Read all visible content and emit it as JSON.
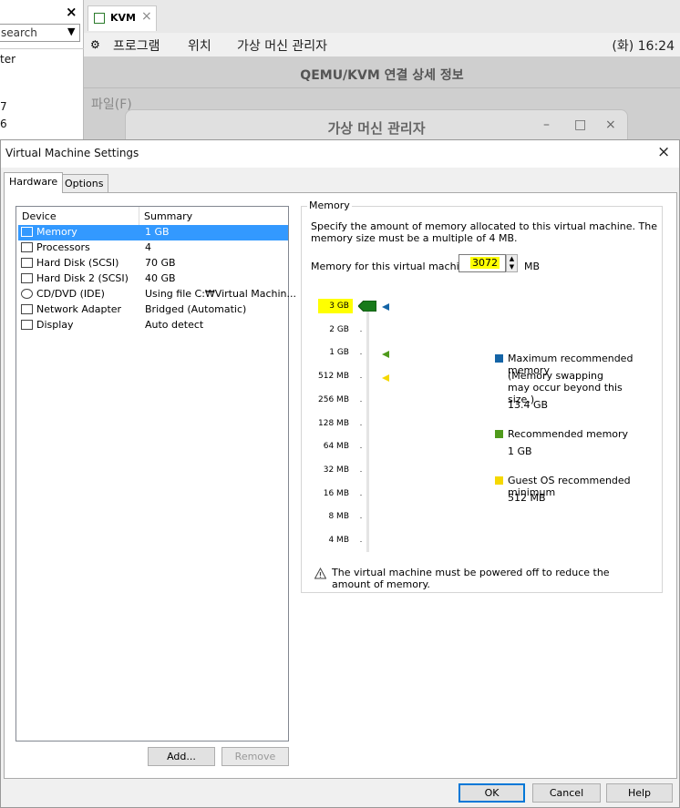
{
  "left_panel": {
    "close_glyph": "×",
    "search_text": "search",
    "items": [
      "ter",
      "7",
      "6"
    ]
  },
  "kvm_tab": {
    "label": "KVM",
    "close_glyph": "×"
  },
  "menubar": {
    "items": [
      "프로그램",
      "위치",
      "가상 머신 관리자"
    ],
    "clock": "(화) 16:24"
  },
  "qemu_window": {
    "title": "QEMU/KVM 연결 상세 정보",
    "file_menu": "파일(F)"
  },
  "vmm_window": {
    "title": "가상 머신 관리자",
    "minimize": "–",
    "maximize": "□",
    "close": "×"
  },
  "dialog": {
    "title": "Virtual Machine Settings",
    "close_glyph": "×",
    "tabs": {
      "hardware": "Hardware",
      "options": "Options"
    },
    "device_list": {
      "headers": {
        "device": "Device",
        "summary": "Summary"
      },
      "rows": [
        {
          "device": "Memory",
          "summary": "1 GB",
          "icon": "memory-icon"
        },
        {
          "device": "Processors",
          "summary": "4",
          "icon": "processor-icon"
        },
        {
          "device": "Hard Disk (SCSI)",
          "summary": "70 GB",
          "icon": "hard-disk-icon"
        },
        {
          "device": "Hard Disk 2 (SCSI)",
          "summary": "40 GB",
          "icon": "hard-disk-icon"
        },
        {
          "device": "CD/DVD (IDE)",
          "summary": "Using file C:₩Virtual Machin...",
          "icon": "cd-dvd-icon"
        },
        {
          "device": "Network Adapter",
          "summary": "Bridged (Automatic)",
          "icon": "network-adapter-icon"
        },
        {
          "device": "Display",
          "summary": "Auto detect",
          "icon": "display-icon"
        }
      ]
    },
    "buttons": {
      "add": "Add...",
      "remove": "Remove",
      "ok": "OK",
      "cancel": "Cancel",
      "help": "Help"
    },
    "memory": {
      "group_title": "Memory",
      "description": "Specify the amount of memory allocated to this virtual machine. The memory size must be a multiple of 4 MB.",
      "field_label": "Memory for this virtual machine:",
      "value": "3072",
      "unit": "MB",
      "scale_labels": [
        "3 GB",
        "2 GB",
        "1 GB",
        "512 MB",
        "256 MB",
        "128 MB",
        "64 MB",
        "32 MB",
        "16 MB",
        "8 MB",
        "4 MB"
      ],
      "legend": {
        "max": {
          "title": "Maximum recommended memory",
          "note": "(Memory swapping may occur beyond this size.)",
          "value": "13.4 GB",
          "color": "#1464a6"
        },
        "recommended": {
          "title": "Recommended memory",
          "value": "1 GB",
          "color": "#4f9a1c"
        },
        "guest_min": {
          "title": "Guest OS recommended minimum",
          "value": "512 MB",
          "color": "#f5d800"
        }
      },
      "warning": "The virtual machine must be powered off to reduce the amount of memory."
    }
  }
}
